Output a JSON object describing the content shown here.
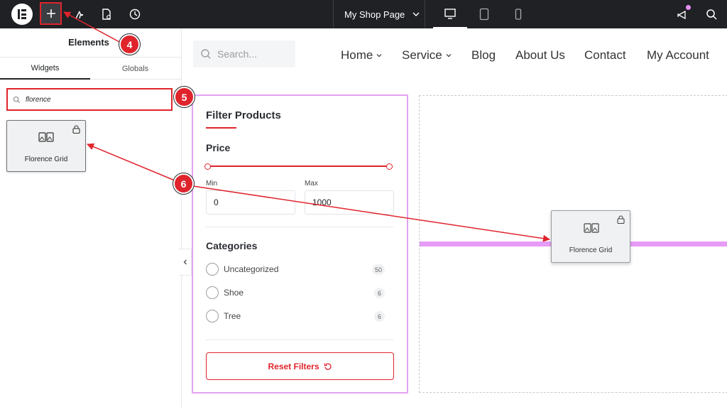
{
  "topbar": {
    "page_name": "My Shop Page"
  },
  "panel": {
    "title": "Elements",
    "tabs": [
      "Widgets",
      "Globals"
    ],
    "search_value": "florence",
    "widget_label": "Florence Grid"
  },
  "site": {
    "search_placeholder": "Search...",
    "nav": [
      "Home",
      "Service",
      "Blog",
      "About Us",
      "Contact",
      "My Account"
    ]
  },
  "filter": {
    "title": "Filter Products",
    "price_heading": "Price",
    "min_label": "Min",
    "max_label": "Max",
    "min_value": "0",
    "max_value": "1000",
    "categories_heading": "Categories",
    "categories": [
      {
        "name": "Uncategorized",
        "count": "50"
      },
      {
        "name": "Shoe",
        "count": "6"
      },
      {
        "name": "Tree",
        "count": "6"
      }
    ],
    "reset_label": "Reset Filters"
  },
  "drag_widget_label": "Florence Grid",
  "annotations": [
    "4",
    "5",
    "6"
  ],
  "colors": {
    "accent": "#e0242c",
    "topbar": "#1f2124",
    "drop_indicator": "#e69cf7",
    "widget_outline": "#e3a3f2"
  },
  "icons": [
    "elementor-logo-icon",
    "plus-icon",
    "sparkle-icon",
    "page-settings-icon",
    "history-icon",
    "desktop-icon",
    "tablet-icon",
    "mobile-icon",
    "notifications-icon",
    "search-icon",
    "grid-widget-icon",
    "pro-lock-icon",
    "reset-icon"
  ]
}
